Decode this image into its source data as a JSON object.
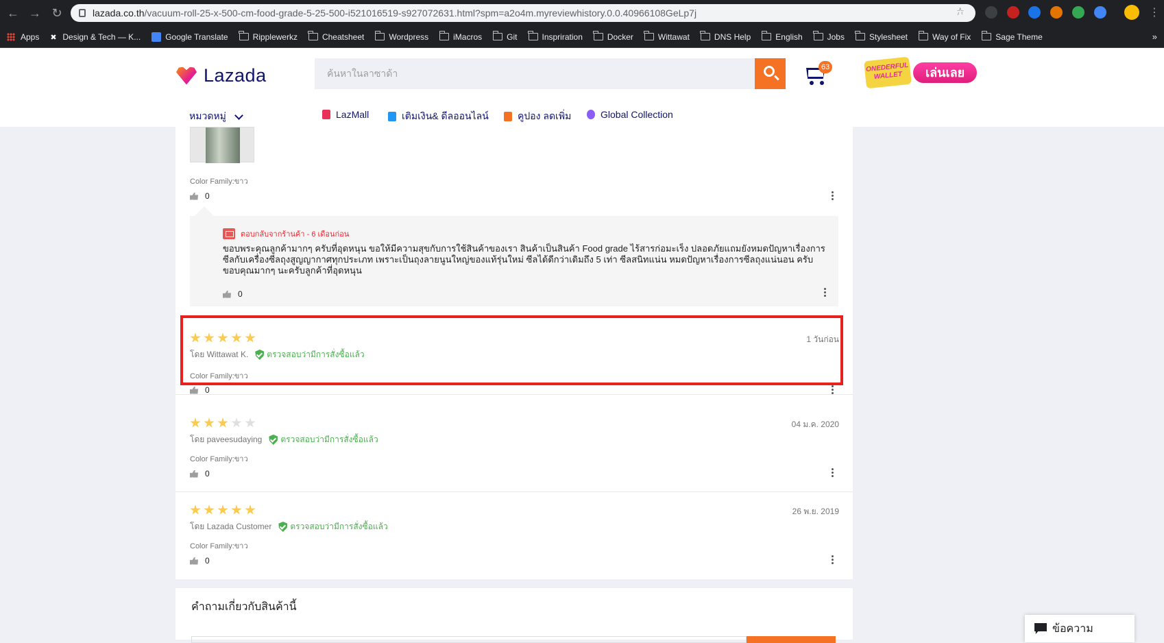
{
  "browser": {
    "url_host": "lazada.co.th",
    "url_path": "/vacuum-roll-25-x-500-cm-food-grade-5-25-500-i521016519-s927072631.html?spm=a2o4m.myreviewhistory.0.0.40966108GeLp7j",
    "bookmarks": [
      "Apps",
      "Design & Tech — K...",
      "Google Translate",
      "Ripplewerkz",
      "Cheatsheet",
      "Wordpress",
      "iMacros",
      "Git",
      "Inspriration",
      "Docker",
      "Wittawat",
      "DNS Help",
      "English",
      "Jobs",
      "Stylesheet",
      "Way of Fix",
      "Sage Theme"
    ],
    "more": "»"
  },
  "header": {
    "logo": "Lazada",
    "search_placeholder": "ค้นหาในลาซาด้า",
    "cart_count": "63",
    "promo_logo": "ONEDERFUL WALLET",
    "promo_button": "เล่นเลย",
    "categories": "หมวดหมู่",
    "nav": [
      "LazMall",
      "เติมเงิน& ดีลออนไลน์",
      "คูปอง ลดเพิ่ม",
      "Global Collection"
    ]
  },
  "first_review": {
    "color_family": "Color Family:ขาว",
    "likes": "0"
  },
  "seller_reply": {
    "header": "ตอบกลับจากร้านค้า - 6 เดือนก่อน",
    "text": "ขอบพระคุณลูกค้ามากๆ ครับที่อุดหนุน ขอให้มีความสุขกับการใช้สินค้าของเรา สินค้าเป็นสินค้า Food grade ไร้สารก่อมะเร็ง ปลอดภัยแถมยังหมดปัญหาเรื่องการซีลกับเครื่องซีลถุงสูญญากาศทุกประเภท เพราะเป็นถุงลายนูนใหญ่ของแท้รุ่นใหม่ ซีลได้ดีกว่าเดิมถึง 5 เท่า ซีลสนิทแน่น หมดปัญหาเรื่องการซีลถุงแน่นอน ครับ ขอบคุณมากๆ นะครับลูกค้าที่อุดหนุน",
    "likes": "0"
  },
  "reviews": [
    {
      "rating": 5,
      "author": "โดย Wittawat K.",
      "verified": "ตรวจสอบว่ามีการสั่งซื้อแล้ว",
      "date": "1 วันก่อน",
      "color_family": "Color Family:ขาว",
      "likes": "0"
    },
    {
      "rating": 3,
      "author": "โดย paveesudaying",
      "verified": "ตรวจสอบว่ามีการสั่งซื้อแล้ว",
      "date": "04 ม.ค. 2020",
      "color_family": "Color Family:ขาว",
      "likes": "0"
    },
    {
      "rating": 5,
      "author": "โดย Lazada Customer",
      "verified": "ตรวจสอบว่ามีการสั่งซื้อแล้ว",
      "date": "26 พ.ย. 2019",
      "color_family": "Color Family:ขาว",
      "likes": "0"
    }
  ],
  "questions": {
    "title": "คำถามเกี่ยวกับสินค้านี้"
  },
  "chat": {
    "label": "ข้อความ"
  },
  "colors": {
    "brand_orange": "#f57224",
    "brand_navy": "#0f146d",
    "highlight": "#e8211f",
    "verified_green": "#4caf50",
    "star": "#faca51"
  }
}
